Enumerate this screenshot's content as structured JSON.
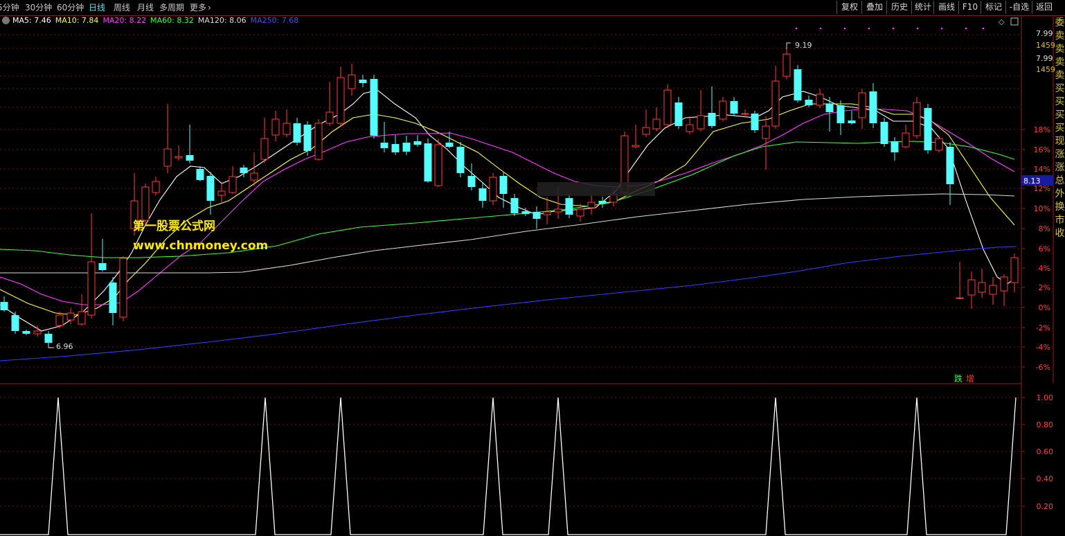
{
  "toolbar": {
    "periods": [
      {
        "label": "5分钟",
        "active": false
      },
      {
        "label": "30分钟",
        "active": false
      },
      {
        "label": "60分钟",
        "active": false
      },
      {
        "label": "日线",
        "active": true
      },
      {
        "label": "周线",
        "active": false
      },
      {
        "label": "月线",
        "active": false
      },
      {
        "label": "多周期",
        "active": false
      },
      {
        "label": "更多",
        "active": false
      }
    ],
    "more_chevron": "›",
    "buttons": [
      "复权",
      "叠加",
      "历史",
      "统计",
      "画线",
      "F10",
      "标记",
      "-自选",
      "返回"
    ]
  },
  "ma_legend": [
    {
      "label": "MA5: 7.46",
      "color": "#ffffff"
    },
    {
      "label": "MA10: 7.84",
      "color": "#ffff4a"
    },
    {
      "label": "MA20: 8.22",
      "color": "#ff40ff"
    },
    {
      "label": "MA60: 8.32",
      "color": "#40ff40"
    },
    {
      "label": "MA120: 8.06",
      "color": "#dddddd"
    },
    {
      "label": "MA250: 7.68",
      "color": "#3b3bff"
    }
  ],
  "price_panel": {
    "pct_ticks": [
      "18%",
      "16%",
      "14%",
      "12%",
      "10%",
      "8%",
      "6%",
      "4%",
      "2%",
      "0%",
      "-2%",
      "-4%",
      "-6%"
    ],
    "top_quote": {
      "price1": "7.99",
      "vol1": "1459",
      "price2": "7.99",
      "vol2": "1459"
    },
    "current_price": "8.13",
    "high_label": "9.19",
    "low_label": "6.96",
    "tags": {
      "down": "跌",
      "up": "增"
    }
  },
  "indicator_panel": {
    "ticks": [
      "1.00",
      "0.80",
      "0.60",
      "0.40",
      "0.20"
    ]
  },
  "watermark": {
    "line1": "第一股票公式网",
    "line2": "www.chnmoney.com"
  },
  "side_panel": [
    "委",
    "卖",
    "卖",
    "卖",
    "卖",
    "买",
    "买",
    "买",
    "买",
    "现",
    "涨",
    "涨",
    "总",
    "外",
    "换",
    "市",
    "收"
  ],
  "colors": {
    "up": "#ff3a3a",
    "down": "#54fcfc",
    "grid": "#7a1a1a",
    "text": "#c8c8c8"
  }
}
